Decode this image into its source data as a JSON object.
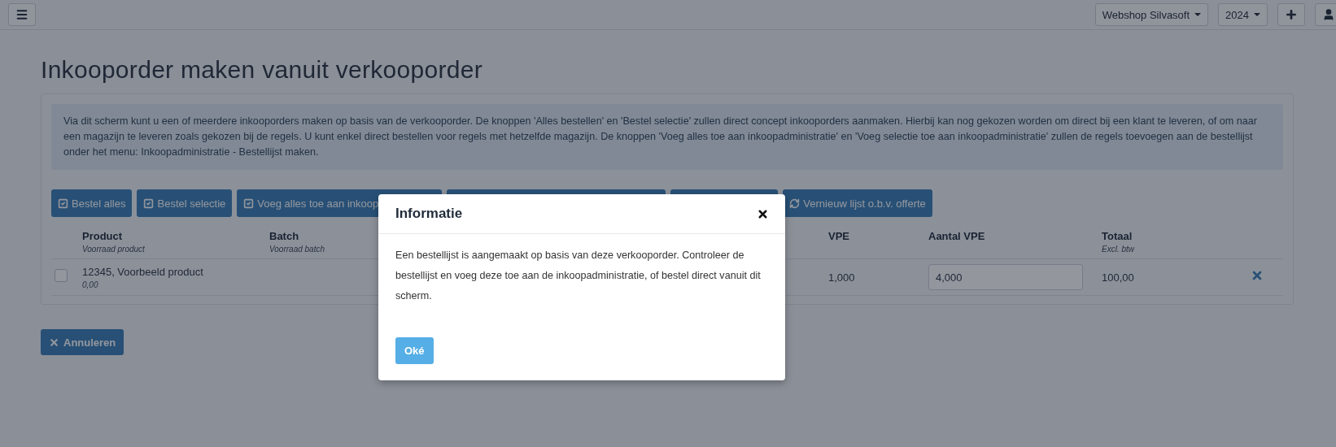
{
  "topbar": {
    "workspace": "Webshop Silvasoft",
    "year": "2024"
  },
  "page": {
    "title": "Inkooporder maken vanuit verkooporder",
    "info": "Via dit scherm kunt u een of meerdere inkooporders maken op basis van de verkooporder. De knoppen 'Alles bestellen' en 'Bestel selectie' zullen direct concept inkooporders aanmaken. Hierbij kan nog gekozen worden om direct bij een klant te leveren, of om naar een magazijn te leveren zoals gekozen bij de regels. U kunt enkel direct bestellen voor regels met hetzelfde magazijn. De knoppen 'Voeg alles toe aan inkoopadministratie' en 'Voeg selectie toe aan inkoopadministratie' zullen de regels toevoegen aan de bestellijst onder het menu: Inkoopadministratie - Bestellijst maken.",
    "actions": [
      {
        "kind": "check",
        "label": "Bestel alles"
      },
      {
        "kind": "check",
        "label": "Bestel selectie"
      },
      {
        "kind": "cut",
        "label": "Voeg alles toe aan inkoop"
      },
      {
        "kind": "covered"
      },
      {
        "kind": "covered"
      },
      {
        "kind": "refresh",
        "label": "Vernieuw lijst o.b.v. offerte"
      }
    ],
    "table": {
      "columns": [
        {
          "label": "Product",
          "sub": "Voorraad product"
        },
        {
          "label": "Batch",
          "sub": "Voorraad batch"
        },
        {
          "label": "VPE"
        },
        {
          "label": "Aantal VPE"
        },
        {
          "label": "Totaal",
          "sub": "Excl. btw"
        }
      ],
      "rows": [
        {
          "checked": false,
          "product": "12345, Voorbeeld product",
          "stock": "0,00",
          "vpe": "1,000",
          "quantity": "4,000",
          "total": "100,00"
        }
      ]
    },
    "cancel": "Annuleren"
  },
  "dialog": {
    "title": "Informatie",
    "message": "Een bestellijst is aangemaakt op basis van deze verkooporder. Controleer de bestellijst en voeg deze toe aan de inkoopadministratie, of bestel direct vanuit dit scherm.",
    "ok": "Oké"
  }
}
